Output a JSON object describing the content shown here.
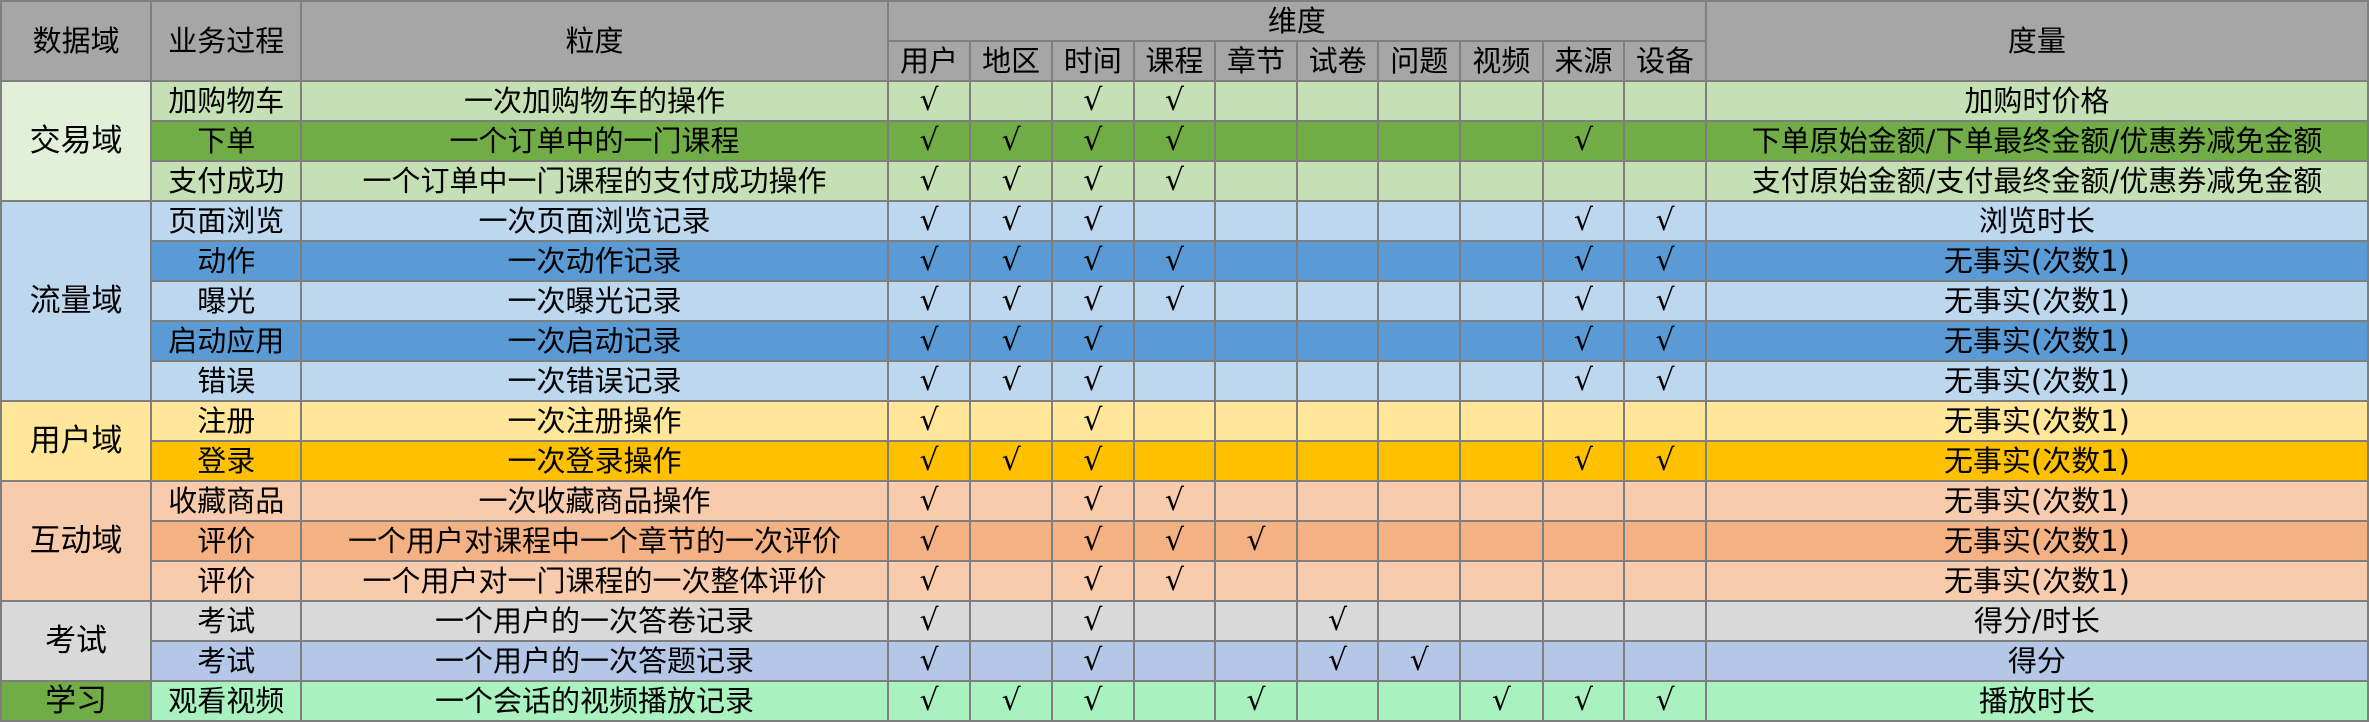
{
  "headers": {
    "domain": "数据域",
    "process": "业务过程",
    "grain": "粒度",
    "dimensions": "维度",
    "measure": "度量",
    "dims": [
      "用户",
      "地区",
      "时间",
      "课程",
      "章节",
      "试卷",
      "问题",
      "视频",
      "来源",
      "设备"
    ]
  },
  "check_mark": "√",
  "colors": {
    "header": "#a6a6a6",
    "trade_domain": "#e2f0d9",
    "trade_light": "#c5e0b4",
    "trade_dark": "#70ad47",
    "traffic_domain": "#bdd7ee",
    "traffic_light": "#bdd7ee",
    "traffic_dark": "#5b9bd5",
    "user_domain": "#ffe699",
    "user_light": "#ffe699",
    "user_dark": "#ffc000",
    "interaction_domain": "#f8cbad",
    "interaction_light": "#f8cbad",
    "interaction_dark": "#f4b183",
    "exam_domain": "#d9d9d9",
    "exam_light": "#d9d9d9",
    "exam_dark": "#b4c7e7",
    "study": "#a9f2c0"
  },
  "groups": [
    {
      "domain": "交易域",
      "domain_color": "#e2f0d9",
      "rows": [
        {
          "process": "加购物车",
          "grain": "一次加购物车的操作",
          "dims": [
            1,
            0,
            1,
            1,
            0,
            0,
            0,
            0,
            0,
            0
          ],
          "measure": "加购时价格",
          "color": "#c5e0b4"
        },
        {
          "process": "下单",
          "grain": "一个订单中的一门课程",
          "dims": [
            1,
            1,
            1,
            1,
            0,
            0,
            0,
            0,
            1,
            0
          ],
          "measure": "下单原始金额/下单最终金额/优惠券减免金额",
          "color": "#70ad47"
        },
        {
          "process": "支付成功",
          "grain": "一个订单中一门课程的支付成功操作",
          "dims": [
            1,
            1,
            1,
            1,
            0,
            0,
            0,
            0,
            0,
            0
          ],
          "measure": "支付原始金额/支付最终金额/优惠券减免金额",
          "color": "#c5e0b4"
        }
      ]
    },
    {
      "domain": "流量域",
      "domain_color": "#bdd7ee",
      "rows": [
        {
          "process": "页面浏览",
          "grain": "一次页面浏览记录",
          "dims": [
            1,
            1,
            1,
            0,
            0,
            0,
            0,
            0,
            1,
            1
          ],
          "measure": "浏览时长",
          "color": "#bdd7ee"
        },
        {
          "process": "动作",
          "grain": "一次动作记录",
          "dims": [
            1,
            1,
            1,
            1,
            0,
            0,
            0,
            0,
            1,
            1
          ],
          "measure": "无事实(次数1)",
          "color": "#5b9bd5"
        },
        {
          "process": "曝光",
          "grain": "一次曝光记录",
          "dims": [
            1,
            1,
            1,
            1,
            0,
            0,
            0,
            0,
            1,
            1
          ],
          "measure": "无事实(次数1)",
          "color": "#bdd7ee"
        },
        {
          "process": "启动应用",
          "grain": "一次启动记录",
          "dims": [
            1,
            1,
            1,
            0,
            0,
            0,
            0,
            0,
            1,
            1
          ],
          "measure": "无事实(次数1)",
          "color": "#5b9bd5"
        },
        {
          "process": "错误",
          "grain": "一次错误记录",
          "dims": [
            1,
            1,
            1,
            0,
            0,
            0,
            0,
            0,
            1,
            1
          ],
          "measure": "无事实(次数1)",
          "color": "#bdd7ee"
        }
      ]
    },
    {
      "domain": "用户域",
      "domain_color": "#ffe699",
      "rows": [
        {
          "process": "注册",
          "grain": "一次注册操作",
          "dims": [
            1,
            0,
            1,
            0,
            0,
            0,
            0,
            0,
            0,
            0
          ],
          "measure": "无事实(次数1)",
          "color": "#ffe699"
        },
        {
          "process": "登录",
          "grain": "一次登录操作",
          "dims": [
            1,
            1,
            1,
            0,
            0,
            0,
            0,
            0,
            1,
            1
          ],
          "measure": "无事实(次数1)",
          "color": "#ffc000"
        }
      ]
    },
    {
      "domain": "互动域",
      "domain_color": "#f8cbad",
      "rows": [
        {
          "process": "收藏商品",
          "grain": "一次收藏商品操作",
          "dims": [
            1,
            0,
            1,
            1,
            0,
            0,
            0,
            0,
            0,
            0
          ],
          "measure": "无事实(次数1)",
          "color": "#f8cbad"
        },
        {
          "process": "评价",
          "grain": "一个用户对课程中一个章节的一次评价",
          "dims": [
            1,
            0,
            1,
            1,
            1,
            0,
            0,
            0,
            0,
            0
          ],
          "measure": "无事实(次数1)",
          "color": "#f4b183"
        },
        {
          "process": "评价",
          "grain": "一个用户对一门课程的一次整体评价",
          "dims": [
            1,
            0,
            1,
            1,
            0,
            0,
            0,
            0,
            0,
            0
          ],
          "measure": "无事实(次数1)",
          "color": "#f8cbad"
        }
      ]
    },
    {
      "domain": "考试",
      "domain_color": "#d9d9d9",
      "rows": [
        {
          "process": "考试",
          "grain": "一个用户的一次答卷记录",
          "dims": [
            1,
            0,
            1,
            0,
            0,
            1,
            0,
            0,
            0,
            0
          ],
          "measure": "得分/时长",
          "color": "#d9d9d9"
        },
        {
          "process": "考试",
          "grain": "一个用户的一次答题记录",
          "dims": [
            1,
            0,
            1,
            0,
            0,
            1,
            1,
            0,
            0,
            0
          ],
          "measure": "得分",
          "color": "#b4c7e7"
        }
      ]
    },
    {
      "domain": "学习",
      "domain_color": "#70ad47",
      "rows": [
        {
          "process": "观看视频",
          "grain": "一个会话的视频播放记录",
          "dims": [
            1,
            1,
            1,
            0,
            1,
            0,
            0,
            1,
            1,
            1
          ],
          "measure": "播放时长",
          "color": "#a9f2c0"
        }
      ]
    }
  ]
}
